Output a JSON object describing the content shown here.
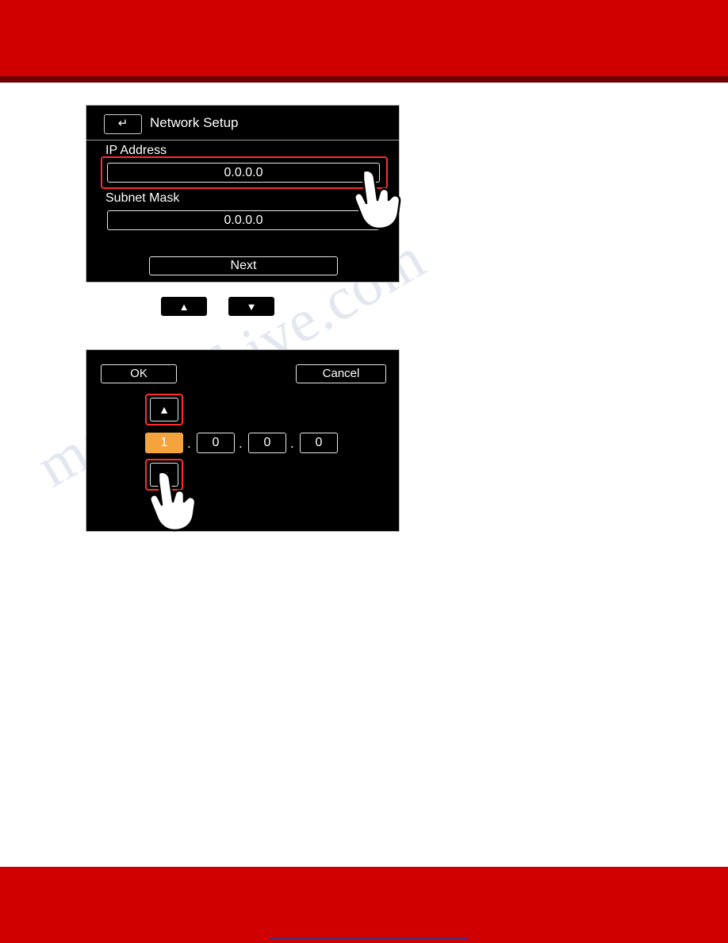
{
  "page": {
    "watermark_lines": [
      "manualshive.com"
    ],
    "banner_color": "#d10000"
  },
  "network_setup_screen": {
    "back_icon": "back-arrow-icon",
    "title": "Network Setup",
    "fields": [
      {
        "label": "IP Address",
        "value": "0.0.0.0",
        "highlighted": true
      },
      {
        "label": "Subnet Mask",
        "value": "0.0.0.0",
        "highlighted": false
      }
    ],
    "next_button": "Next"
  },
  "middle_buttons": [
    {
      "name": "up-button",
      "glyph": "▲"
    },
    {
      "name": "down-button",
      "glyph": "▼"
    }
  ],
  "keypad_screen": {
    "ok_button": "OK",
    "cancel_button": "Cancel",
    "up_button": "▲",
    "down_button": "▼",
    "separator": ".",
    "octets": [
      {
        "value": "1",
        "selected": true
      },
      {
        "value": "0",
        "selected": false
      },
      {
        "value": "0",
        "selected": false
      },
      {
        "value": "0",
        "selected": false
      }
    ],
    "selected_color": "#f5a33c",
    "highlight_color": "#ff2d2d"
  }
}
